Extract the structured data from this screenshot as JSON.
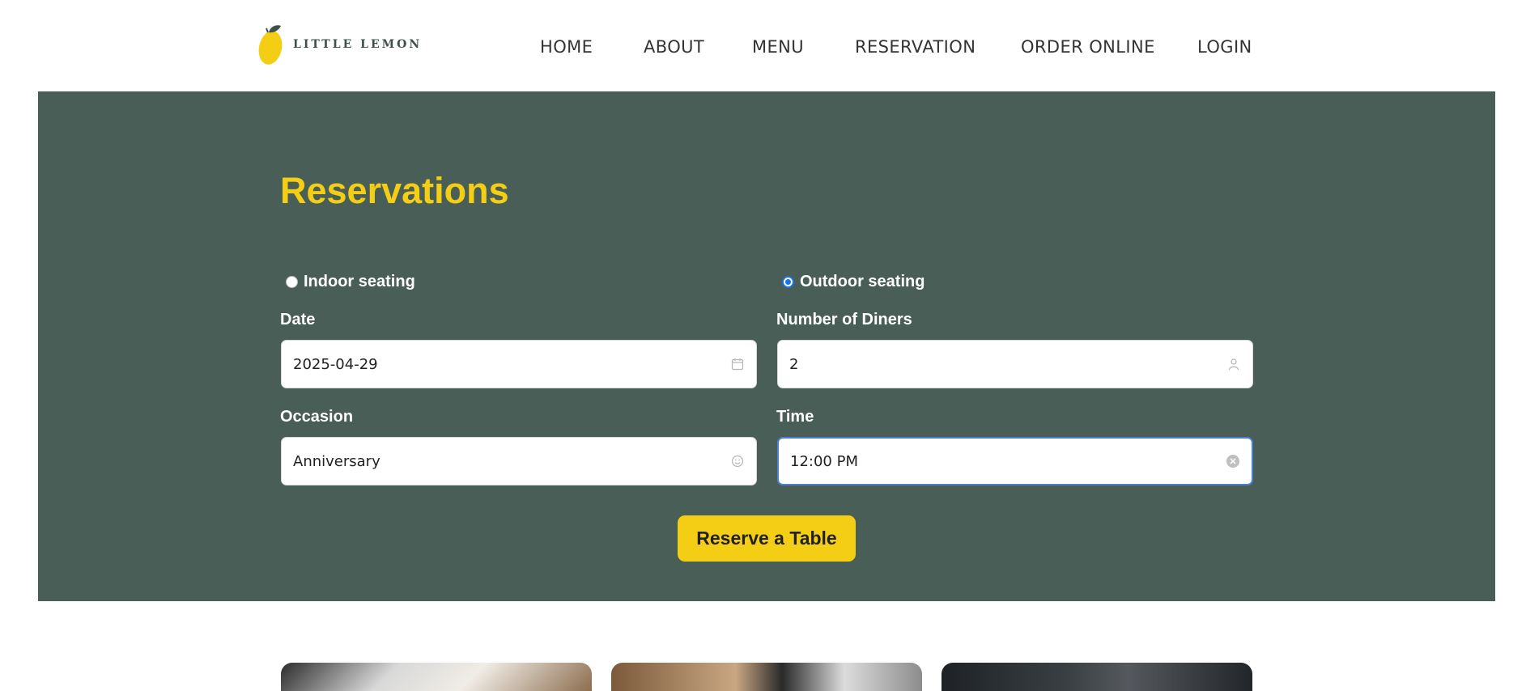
{
  "brand": {
    "name": "LITTLE LEMON"
  },
  "nav": {
    "items": [
      {
        "label": "HOME"
      },
      {
        "label": "ABOUT"
      },
      {
        "label": "MENU"
      },
      {
        "label": "RESERVATION"
      },
      {
        "label": "ORDER ONLINE"
      },
      {
        "label": "LOGIN"
      }
    ]
  },
  "reservation": {
    "title": "Reservations",
    "seating": {
      "indoor_label": "Indoor seating",
      "outdoor_label": "Outdoor seating",
      "selected": "outdoor"
    },
    "date": {
      "label": "Date",
      "value": "2025-04-29",
      "icon": "calendar-icon"
    },
    "diners": {
      "label": "Number of Diners",
      "value": "2",
      "icon": "user-icon"
    },
    "occasion": {
      "label": "Occasion",
      "value": "Anniversary",
      "icon": "smile-icon"
    },
    "time": {
      "label": "Time",
      "value": "12:00 PM",
      "icon": "clear-icon"
    },
    "submit_label": "Reserve a Table"
  },
  "colors": {
    "primary_green": "#495e57",
    "primary_yellow": "#f4ce14",
    "focus_blue": "#4a7fd0"
  }
}
